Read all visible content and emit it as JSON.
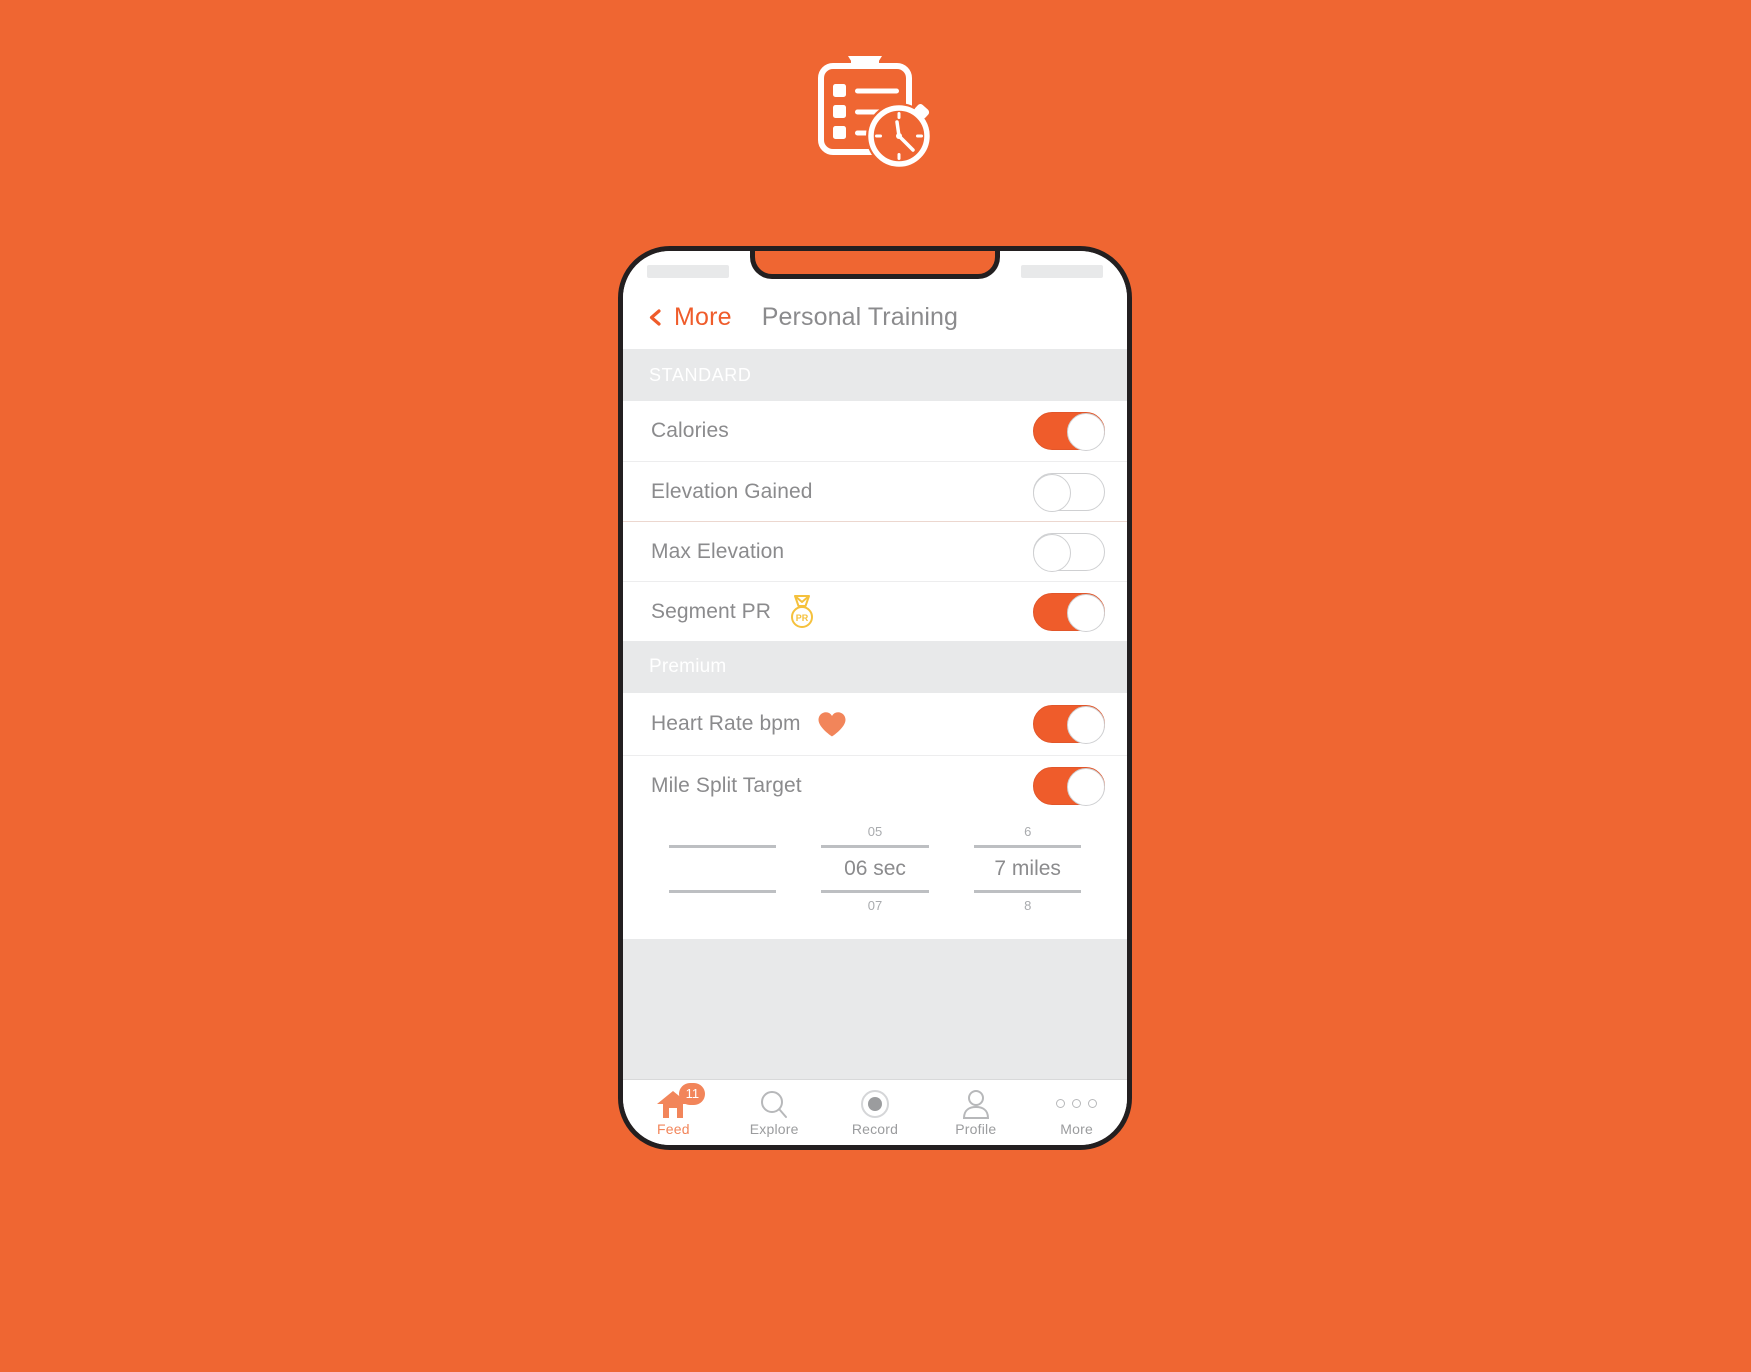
{
  "theme": {
    "background": "#ef6632",
    "accent": "#ef5c2b",
    "accent_soft": "#f2855a",
    "medal_gold": "#f5c13d",
    "text_grey": "#8b8b8d",
    "section_bg": "#e8e9ea"
  },
  "logo": {
    "name": "clipboard-stopwatch-logo"
  },
  "statusbar": {
    "left_placeholder": "",
    "right_placeholder": ""
  },
  "navbar": {
    "back_label": "More",
    "title": "Personal Training"
  },
  "sections": [
    {
      "header": "STANDARD",
      "rows": [
        {
          "label": "Calories",
          "toggle": "on",
          "badge": null
        },
        {
          "label": "Elevation Gained",
          "toggle": "off",
          "badge": null
        },
        {
          "label": "Max Elevation",
          "toggle": "off",
          "badge": null
        },
        {
          "label": "Segment PR",
          "toggle": "on",
          "badge": "pr-medal-icon"
        }
      ]
    },
    {
      "header": "Premium",
      "rows": [
        {
          "label": "Heart Rate bpm",
          "toggle": "on",
          "badge": "heart-icon"
        },
        {
          "label": "Mile Split Target",
          "toggle": "on",
          "badge": null
        }
      ]
    }
  ],
  "picker": {
    "columns": [
      {
        "above": "",
        "value": "",
        "below": ""
      },
      {
        "above": "05",
        "value": "06 sec",
        "below": "07"
      },
      {
        "above": "6",
        "value": "7 miles",
        "below": "8"
      }
    ]
  },
  "tabbar": {
    "tabs": [
      {
        "label": "Feed",
        "icon": "home-icon",
        "badge": "11",
        "active": true
      },
      {
        "label": "Explore",
        "icon": "search-icon",
        "badge": null,
        "active": false
      },
      {
        "label": "Record",
        "icon": "record-icon",
        "badge": null,
        "active": false
      },
      {
        "label": "Profile",
        "icon": "person-icon",
        "badge": null,
        "active": false
      },
      {
        "label": "More",
        "icon": "ellipsis-icon",
        "badge": null,
        "active": false
      }
    ]
  }
}
